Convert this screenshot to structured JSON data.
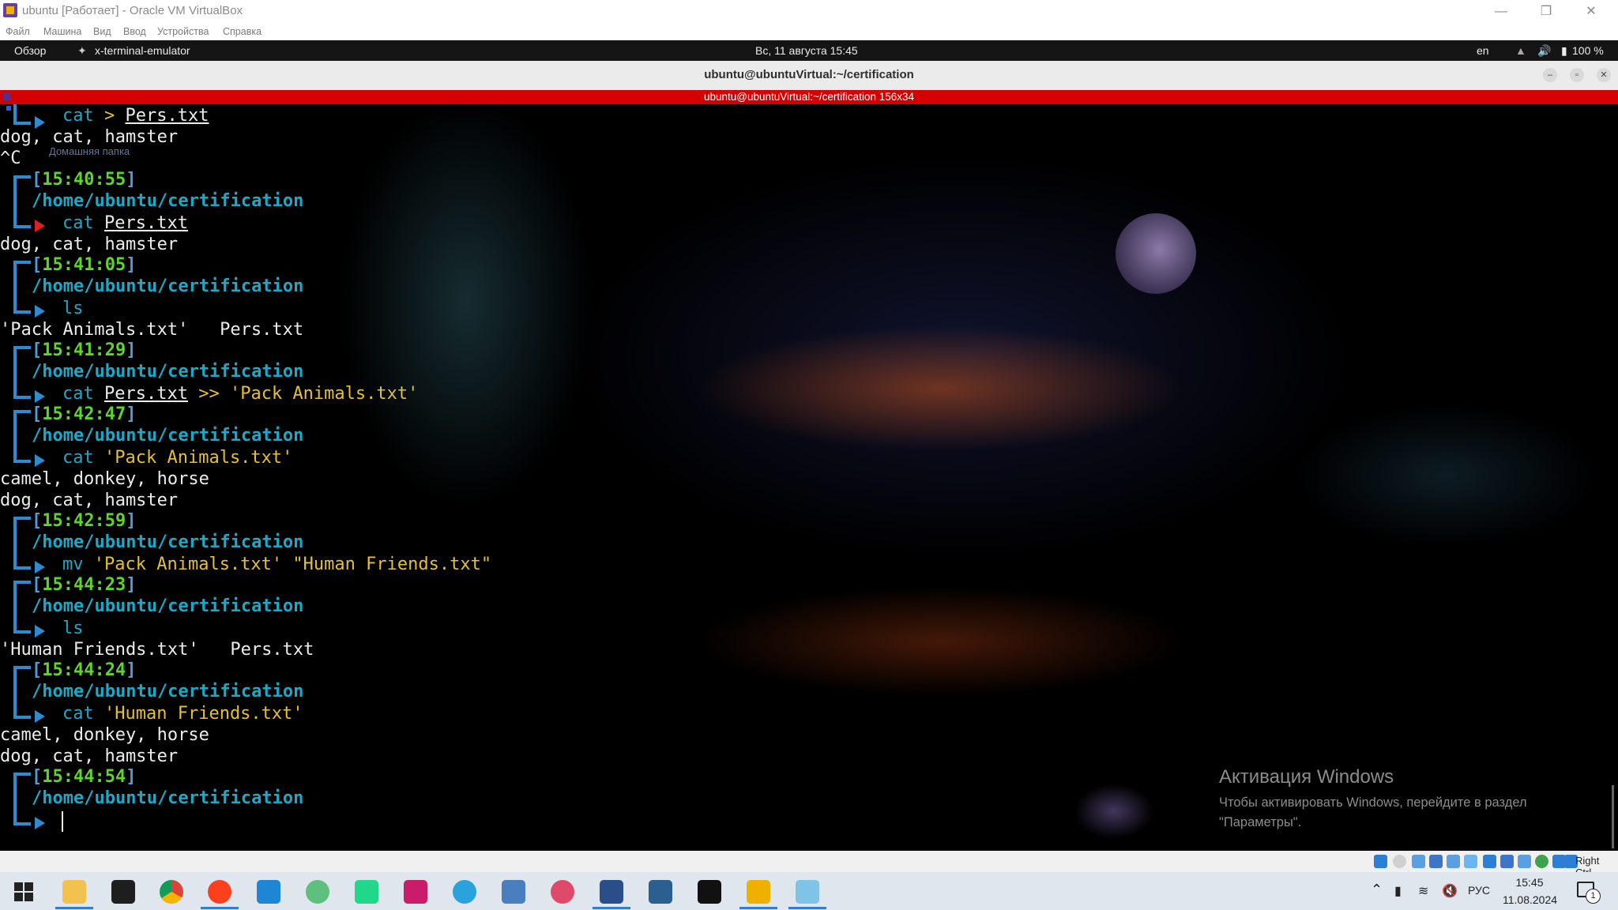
{
  "vbox": {
    "title": "ubuntu [Работает] - Oracle VM VirtualBox",
    "menu": [
      "Файл",
      "Машина",
      "Вид",
      "Ввод",
      "Устройства",
      "Справка"
    ],
    "status_host_key": "Right Ctrl"
  },
  "gnome": {
    "activities": "Обзор",
    "app": "x-terminal-emulator",
    "clock": "Вс, 11 августа  15:45",
    "lang": "en",
    "battery": "100 %"
  },
  "terminal": {
    "window_title": "ubuntu@ubuntuVirtual:~/certification",
    "bar_title": "ubuntu@ubuntuVirtual:~/certification 156x34",
    "faint_label": "Домашняя папка",
    "blocks": [
      {
        "cmd": "cat",
        "rest": " > Pers.txt",
        "output": [
          "dog, cat, hamster",
          "^C"
        ]
      },
      {
        "time": "[15:40:55]",
        "path": "/home/ubuntu/certification",
        "cmd": "cat",
        "arg": "Pers.txt",
        "output": [
          "dog, cat, hamster"
        ]
      },
      {
        "time": "[15:41:05]",
        "path": "/home/ubuntu/certification",
        "cmd": "ls",
        "output": [
          "'Pack Animals.txt'   Pers.txt"
        ]
      },
      {
        "time": "[15:41:29]",
        "path": "/home/ubuntu/certification",
        "cmd": "cat",
        "arg": "Pers.txt",
        "op": ">>",
        "str": "'Pack Animals.txt'"
      },
      {
        "time": "[15:42:47]",
        "path": "/home/ubuntu/certification",
        "cmd": "cat",
        "str": "'Pack Animals.txt'",
        "output": [
          "camel, donkey, horse",
          "dog, cat, hamster"
        ]
      },
      {
        "time": "[15:42:59]",
        "path": "/home/ubuntu/certification",
        "cmd": "mv",
        "str": "'Pack Animals.txt' \"Human Friends.txt\""
      },
      {
        "time": "[15:44:23]",
        "path": "/home/ubuntu/certification",
        "cmd": "ls",
        "output": [
          "'Human Friends.txt'   Pers.txt"
        ]
      },
      {
        "time": "[15:44:24]",
        "path": "/home/ubuntu/certification",
        "cmd": "cat",
        "str": "'Human Friends.txt'",
        "output": [
          "camel, donkey, horse",
          "dog, cat, hamster"
        ]
      },
      {
        "time": "[15:44:54]",
        "path": "/home/ubuntu/certification"
      }
    ]
  },
  "activation": {
    "title": "Активация Windows",
    "line1": "Чтобы активировать Windows, перейдите в раздел",
    "line2": "\"Параметры\"."
  },
  "taskbar": {
    "lang": "РУС",
    "time": "15:45",
    "date": "11.08.2024",
    "notif_count": "1",
    "apps": [
      "file-explorer",
      "terminal",
      "chrome",
      "yandex-browser",
      "vscode",
      "atom",
      "pycharm",
      "intellij",
      "telegram",
      "calculator",
      "snipping-tool",
      "virtualbox-3d",
      "mysql-workbench-1",
      "mysql-workbench-2",
      "virtualbox",
      "notes"
    ]
  }
}
